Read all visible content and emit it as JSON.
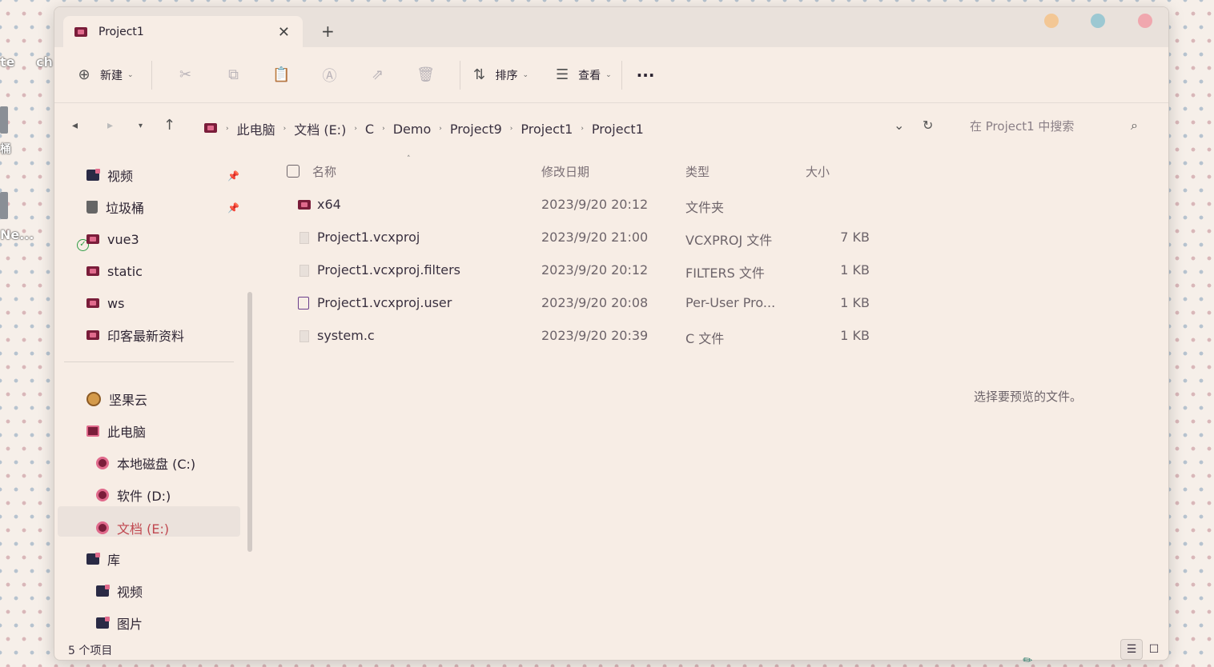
{
  "desktop": {
    "fragments": [
      "te",
      "ch",
      "桶",
      "Ne..."
    ]
  },
  "tab": {
    "title": "Project1",
    "close": "✕",
    "new_tab": "+"
  },
  "colors": {
    "accent_selected": "#c0474f",
    "window_bg": "#f7ede5",
    "traffic_lights": [
      "#f3c795",
      "#9cc8d2",
      "#f0a7ae"
    ]
  },
  "toolbar": {
    "new_label": "新建",
    "sort_label": "排序",
    "view_label": "查看",
    "more_label": "···",
    "icons": [
      "cut-icon",
      "copy-icon",
      "paste-icon",
      "rename-icon",
      "share-icon",
      "delete-icon"
    ]
  },
  "address": {
    "breadcrumb": [
      "此电脑",
      "文档 (E:)",
      "C",
      "Demo",
      "Project9",
      "Project1",
      "Project1"
    ],
    "search_placeholder": "在 Project1 中搜索"
  },
  "sidebar": {
    "quick_access": [
      {
        "label": "视频",
        "pinned": true,
        "icon": "video-library-icon"
      },
      {
        "label": "垃圾桶",
        "pinned": true,
        "icon": "trash-icon"
      },
      {
        "label": "vue3",
        "pinned": false,
        "icon": "folder-icon",
        "synced": true
      },
      {
        "label": "static",
        "pinned": false,
        "icon": "folder-icon"
      },
      {
        "label": "ws",
        "pinned": false,
        "icon": "folder-icon"
      },
      {
        "label": "印客最新资料",
        "pinned": false,
        "icon": "folder-icon"
      }
    ],
    "nutstore": "坚果云",
    "this_pc": "此电脑",
    "drives": [
      "本地磁盘 (C:)",
      "软件 (D:)",
      "文档 (E:)"
    ],
    "library": "库",
    "library_items": [
      "视频",
      "图片"
    ]
  },
  "file_list": {
    "columns": [
      "名称",
      "修改日期",
      "类型",
      "大小"
    ],
    "rows": [
      {
        "name": "x64",
        "date": "2023/9/20 20:12",
        "type": "文件夹",
        "size": "",
        "icon": "folder-icon"
      },
      {
        "name": "Project1.vcxproj",
        "date": "2023/9/20 21:00",
        "type": "VCXPROJ 文件",
        "size": "7 KB",
        "icon": "file-icon"
      },
      {
        "name": "Project1.vcxproj.filters",
        "date": "2023/9/20 20:12",
        "type": "FILTERS 文件",
        "size": "1 KB",
        "icon": "file-icon"
      },
      {
        "name": "Project1.vcxproj.user",
        "date": "2023/9/20 20:08",
        "type": "Per-User Pro...",
        "size": "1 KB",
        "icon": "user-project-icon"
      },
      {
        "name": "system.c",
        "date": "2023/9/20 20:39",
        "type": "C 文件",
        "size": "1 KB",
        "icon": "file-icon"
      }
    ]
  },
  "preview": {
    "message": "选择要预览的文件。"
  },
  "status": {
    "count": "5 个项目"
  }
}
